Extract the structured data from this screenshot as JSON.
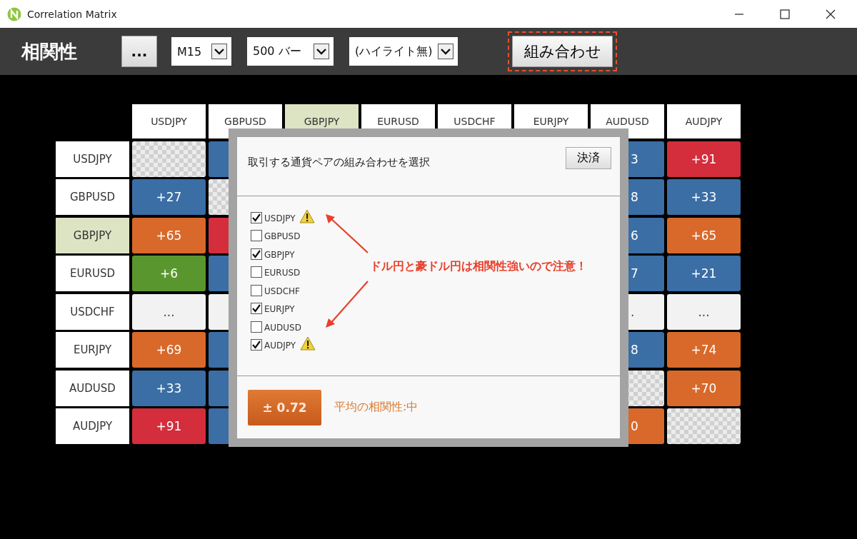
{
  "window": {
    "title": "Correlation Matrix"
  },
  "toolbar": {
    "title": "相関性",
    "more_button": "...",
    "selects": [
      {
        "value": "M15"
      },
      {
        "value": "500 バー"
      },
      {
        "value": "(ハイライト無)"
      }
    ],
    "combine_button": {
      "label": "組み合わせ",
      "highlighted": true
    }
  },
  "matrix": {
    "columns": [
      {
        "label": "USDJPY",
        "highlighted": false
      },
      {
        "label": "GBPUSD",
        "highlighted": false
      },
      {
        "label": "GBPJPY",
        "highlighted": true
      },
      {
        "label": "EURUSD",
        "highlighted": false
      },
      {
        "label": "USDCHF",
        "highlighted": false
      },
      {
        "label": "EURJPY",
        "highlighted": false
      },
      {
        "label": "AUDUSD",
        "highlighted": false
      },
      {
        "label": "AUDJPY",
        "highlighted": false
      }
    ],
    "rows": [
      {
        "label": "USDJPY",
        "highlighted": false,
        "cells": [
          {
            "kind": "self"
          },
          {
            "kind": "value",
            "color": "#3a6ea5"
          },
          {
            "kind": "value",
            "color": "#3a6ea5",
            "text": "3"
          },
          {
            "kind": "value",
            "color": "#d42d3c",
            "text": "+91"
          }
        ]
      },
      {
        "label": "GBPUSD",
        "highlighted": false,
        "cells": [
          {
            "kind": "value",
            "color": "#3a6ea5",
            "text": "+27"
          },
          {
            "kind": "self"
          },
          {
            "kind": "value",
            "color": "#3a6ea5",
            "text": "8"
          },
          {
            "kind": "value",
            "color": "#3a6ea5",
            "text": "+33"
          }
        ]
      },
      {
        "label": "GBPJPY",
        "highlighted": true,
        "cells": [
          {
            "kind": "value",
            "color": "#d8692a",
            "text": "+65"
          },
          {
            "kind": "value",
            "color": "#d42d3c"
          },
          {
            "kind": "value",
            "color": "#3a6ea5",
            "text": "6"
          },
          {
            "kind": "value",
            "color": "#d8692a",
            "text": "+65"
          }
        ]
      },
      {
        "label": "EURUSD",
        "highlighted": false,
        "cells": [
          {
            "kind": "value",
            "color": "#5a962e",
            "text": "+6"
          },
          {
            "kind": "value",
            "color": "#3a6ea5"
          },
          {
            "kind": "value",
            "color": "#3a6ea5",
            "text": "7"
          },
          {
            "kind": "value",
            "color": "#3a6ea5",
            "text": "+21"
          }
        ]
      },
      {
        "label": "USDCHF",
        "highlighted": false,
        "cells": [
          {
            "kind": "none",
            "text": "..."
          },
          {
            "kind": "none"
          },
          {
            "kind": "none",
            "text": "."
          },
          {
            "kind": "none",
            "text": "..."
          }
        ]
      },
      {
        "label": "EURJPY",
        "highlighted": false,
        "cells": [
          {
            "kind": "value",
            "color": "#d8692a",
            "text": "+69"
          },
          {
            "kind": "value",
            "color": "#3a6ea5"
          },
          {
            "kind": "value",
            "color": "#3a6ea5",
            "text": "8"
          },
          {
            "kind": "value",
            "color": "#d8692a",
            "text": "+74"
          }
        ]
      },
      {
        "label": "AUDUSD",
        "highlighted": false,
        "cells": [
          {
            "kind": "value",
            "color": "#3a6ea5",
            "text": "+33"
          },
          {
            "kind": "value",
            "color": "#3a6ea5"
          },
          {
            "kind": "self"
          },
          {
            "kind": "value",
            "color": "#d8692a",
            "text": "+70"
          }
        ]
      },
      {
        "label": "AUDJPY",
        "highlighted": false,
        "cells": [
          {
            "kind": "value",
            "color": "#d42d3c",
            "text": "+91"
          },
          {
            "kind": "value",
            "color": "#3a6ea5"
          },
          {
            "kind": "value",
            "color": "#d8692a",
            "text": "0"
          },
          {
            "kind": "self"
          }
        ]
      }
    ]
  },
  "dialog": {
    "title": "取引する通貨ペアの組み合わせを選択",
    "close_button": "決済",
    "pairs": [
      {
        "label": "USDJPY",
        "checked": true,
        "warning": true
      },
      {
        "label": "GBPUSD",
        "checked": false,
        "warning": false
      },
      {
        "label": "GBPJPY",
        "checked": true,
        "warning": false
      },
      {
        "label": "EURUSD",
        "checked": false,
        "warning": false
      },
      {
        "label": "USDCHF",
        "checked": false,
        "warning": false
      },
      {
        "label": "EURJPY",
        "checked": true,
        "warning": false
      },
      {
        "label": "AUDUSD",
        "checked": false,
        "warning": false
      },
      {
        "label": "AUDJPY",
        "checked": true,
        "warning": true
      }
    ],
    "correlation_value": "± 0.72",
    "correlation_label": "平均の相関性:中"
  },
  "annotation": {
    "text": "ドル円と豪ドル円は相関性強いので注意！"
  }
}
